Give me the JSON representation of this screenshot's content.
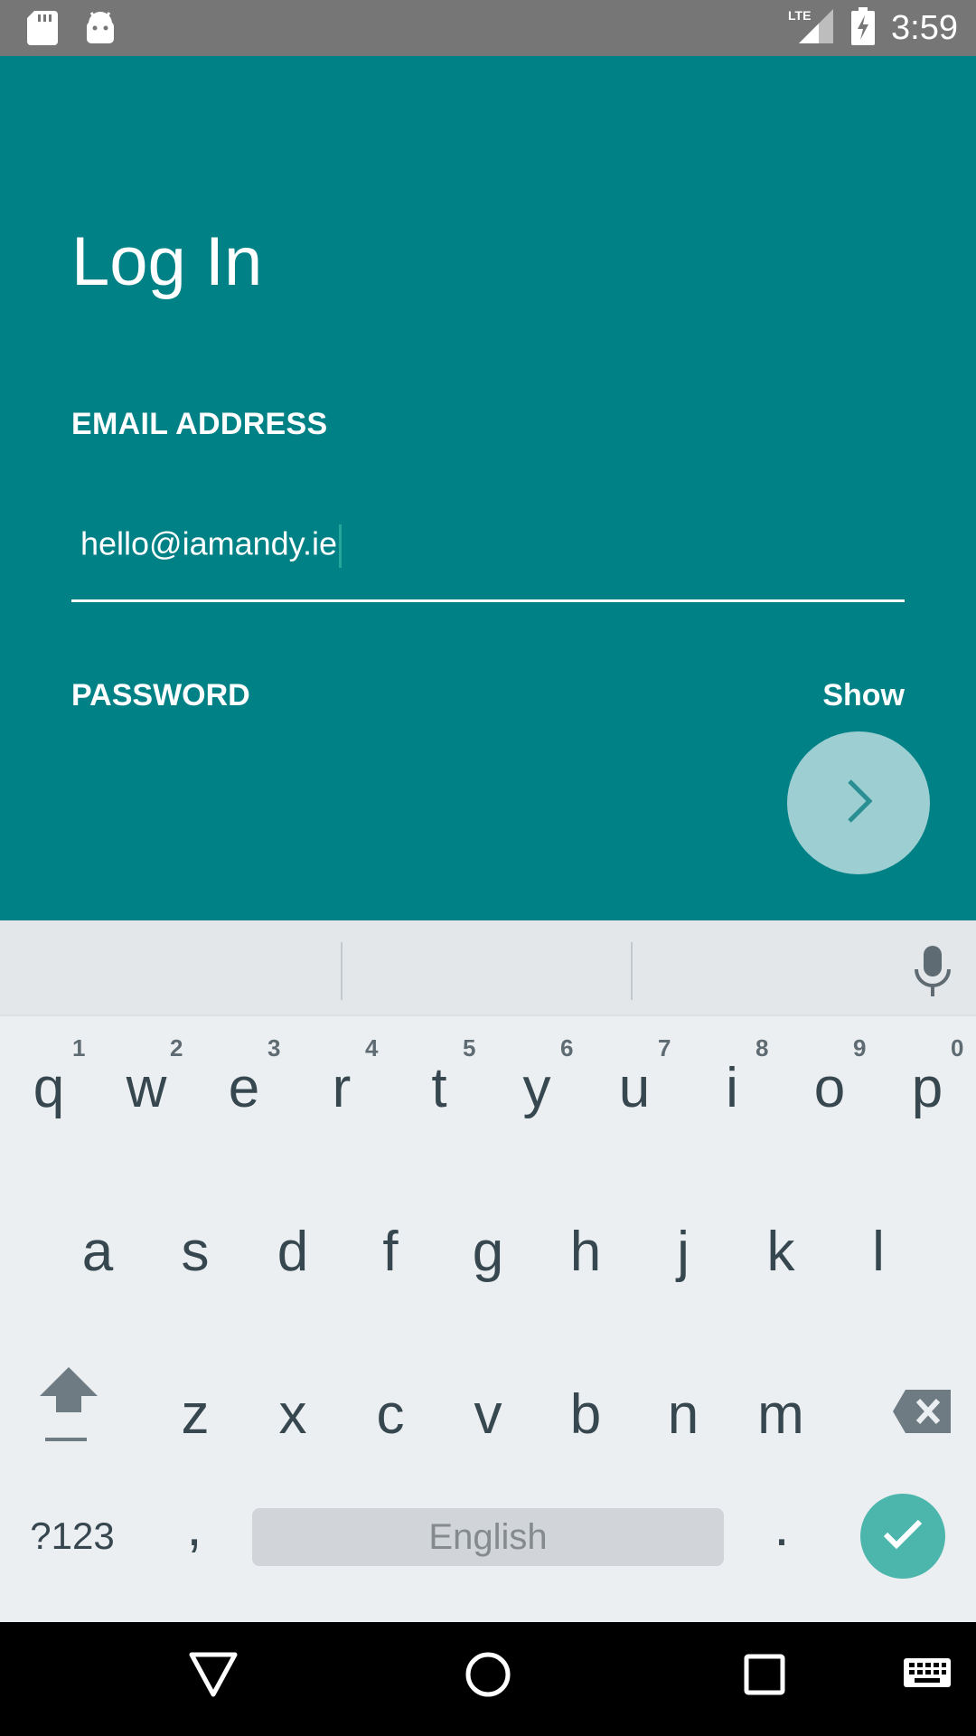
{
  "status_bar": {
    "time": "3:59",
    "network": "LTE",
    "icons": [
      "sd-card-icon",
      "android-icon",
      "lte-signal-icon",
      "battery-charging-icon"
    ]
  },
  "login": {
    "title": "Log In",
    "email_label": "EMAIL ADDRESS",
    "email_value": "hello@iamandy.ie",
    "password_label": "PASSWORD",
    "show_label": "Show",
    "next_icon": "chevron-right-icon"
  },
  "keyboard": {
    "row1": [
      {
        "key": "q",
        "hint": "1"
      },
      {
        "key": "w",
        "hint": "2"
      },
      {
        "key": "e",
        "hint": "3"
      },
      {
        "key": "r",
        "hint": "4"
      },
      {
        "key": "t",
        "hint": "5"
      },
      {
        "key": "y",
        "hint": "6"
      },
      {
        "key": "u",
        "hint": "7"
      },
      {
        "key": "i",
        "hint": "8"
      },
      {
        "key": "o",
        "hint": "9"
      },
      {
        "key": "p",
        "hint": "0"
      }
    ],
    "row2": [
      "a",
      "s",
      "d",
      "f",
      "g",
      "h",
      "j",
      "k",
      "l"
    ],
    "row3": [
      "z",
      "x",
      "c",
      "v",
      "b",
      "n",
      "m"
    ],
    "symbols_label": "?123",
    "comma": ",",
    "space_label": "English",
    "period": ".",
    "shift_icon": "shift-icon",
    "backspace_icon": "backspace-icon",
    "done_icon": "checkmark-icon",
    "mic_icon": "microphone-icon"
  },
  "nav_bar": {
    "icons": [
      "back-triangle-icon",
      "home-circle-icon",
      "recents-square-icon",
      "keyboard-switch-icon"
    ]
  },
  "colors": {
    "primary": "#008186",
    "fab": "#9dced2",
    "accent": "#4db6ac",
    "keyboard_bg": "#eceff1",
    "key_text": "#37474f"
  }
}
